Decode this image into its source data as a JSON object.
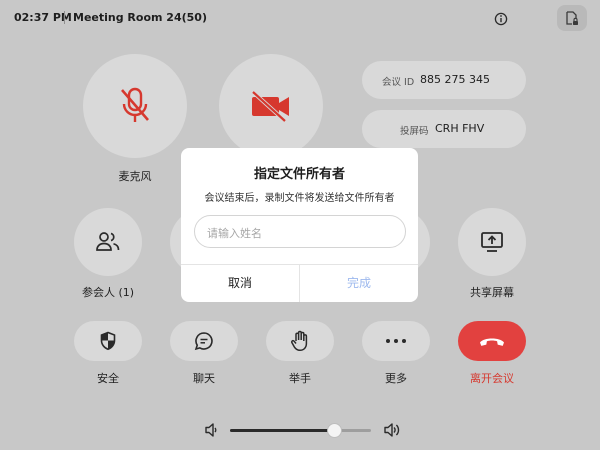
{
  "top_bar": {
    "time": "02:37 PM",
    "room_title": "Meeting Room 24(50)",
    "file_icon": "document-lock-icon"
  },
  "controls": {
    "mic_label": "麦克风",
    "participants_label": "参会人 (1)",
    "share_label": "共享屏幕",
    "security_label": "安全",
    "chat_label": "聊天",
    "raise_hand_label": "举手",
    "more_label": "更多",
    "leave_label": "离开会议"
  },
  "meeting_info": {
    "id_key": "会议 ID",
    "id_value": "885 275 345",
    "code_key": "投屏码",
    "code_value": "CRH FHV"
  },
  "dialog": {
    "title": "指定文件所有者",
    "subtitle": "会议结束后，录制文件将发送给文件所有者",
    "input_placeholder": "请输入姓名",
    "cancel_label": "取消",
    "confirm_label": "完成"
  },
  "volume": {
    "level": 0.74
  },
  "colors": {
    "background": "#c8c8c8",
    "button": "#d9d9d9",
    "leave_red": "#e2413f",
    "muted_icon_red": "#d6382e",
    "confirm_blue_disabled": "#9db9ee"
  }
}
